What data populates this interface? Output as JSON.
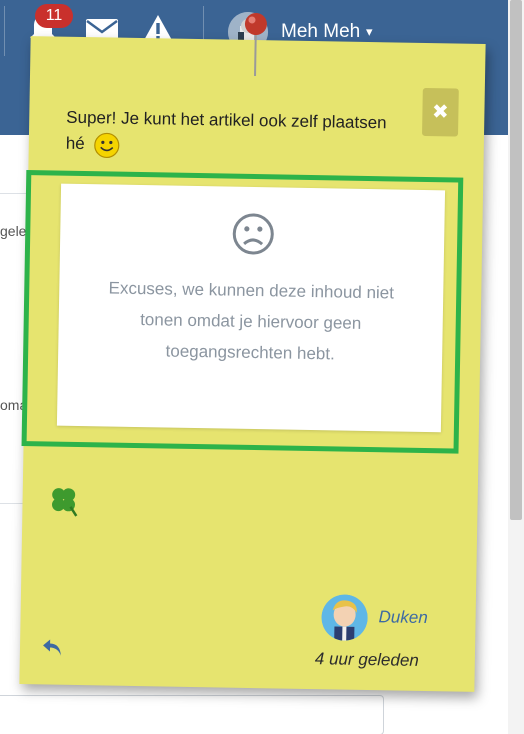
{
  "navbar": {
    "notifications_count": "11",
    "icons": [
      "bell-icon",
      "envelope-icon",
      "warning-icon"
    ],
    "user_name": "Meh Meh",
    "caret": "▾"
  },
  "background_fragments": [
    "gele",
    "oma"
  ],
  "note": {
    "message": "Super! Je kunt het artikel ook zelf plaatsen hé",
    "close_label": "✖",
    "restricted_message": "Excuses, we kunnen deze inhoud niet tonen omdat je hiervoor geen toegangsrechten hebt.",
    "author": "Duken",
    "timestamp": "4 uur geleden",
    "colors": {
      "note_background": "#e6e46f",
      "frame_highlight": "#2db34a",
      "navbar": "#3b6494"
    }
  }
}
